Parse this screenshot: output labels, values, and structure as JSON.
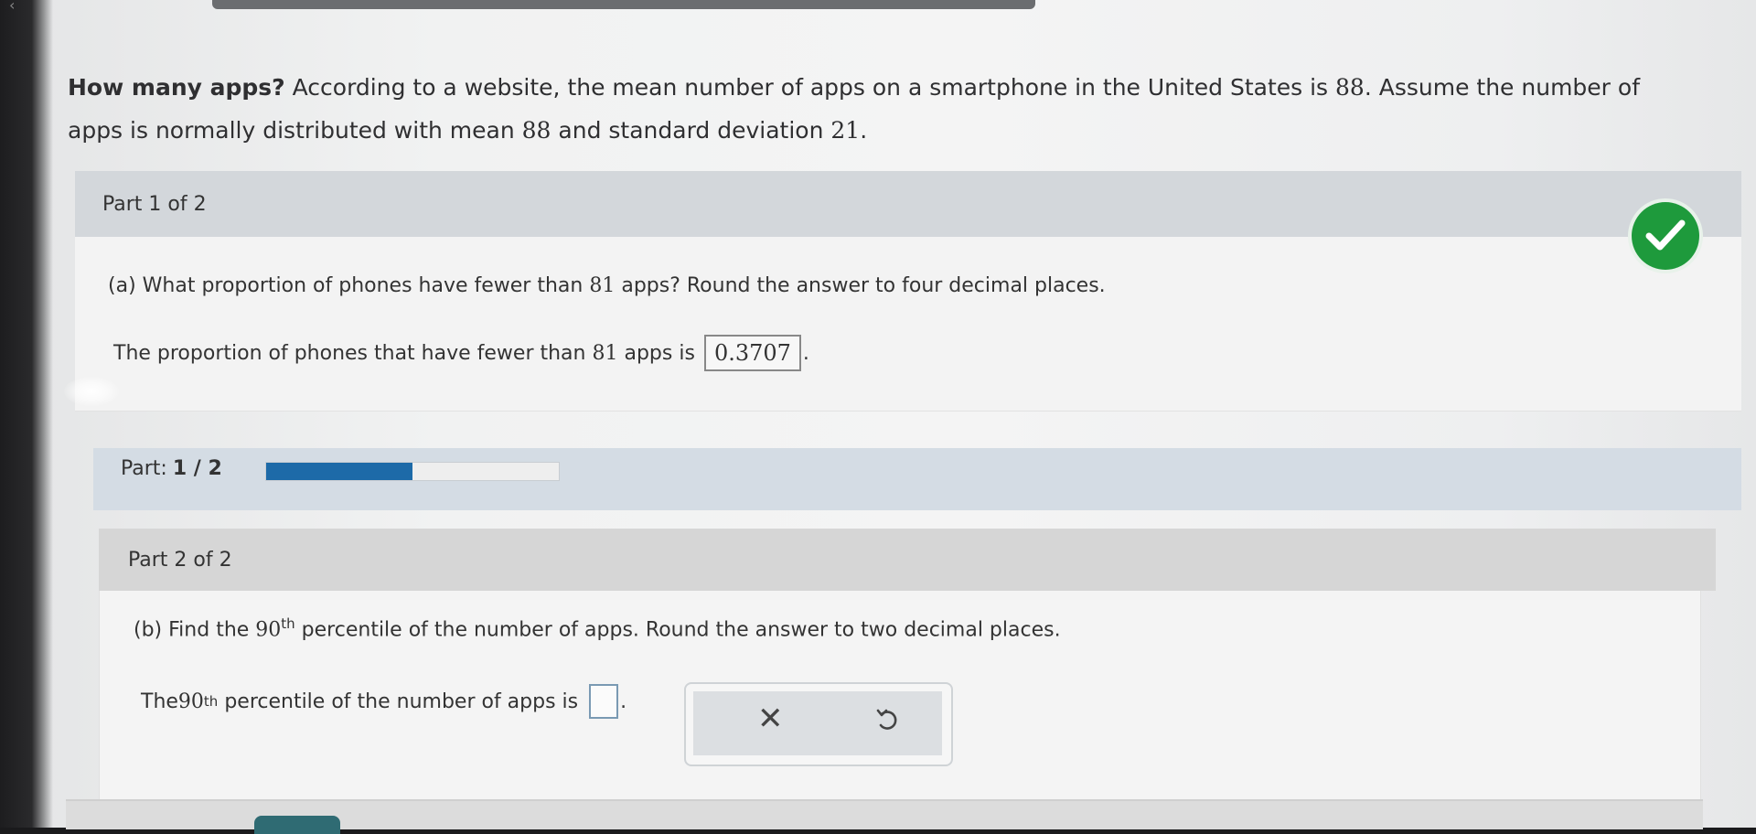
{
  "question": {
    "title": "How many apps?",
    "text_prefix": "According to a website, the mean number of apps on a smartphone in the United States is ",
    "mean": "88",
    "text_mid": ". Assume the number of apps is normally distributed with mean ",
    "mean2": "88",
    "text_and": " and standard deviation ",
    "sd": "21",
    "text_end": "."
  },
  "part1": {
    "header": "Part 1 of 2",
    "question_prefix": "(a) What proportion of phones have fewer than ",
    "question_num": "81",
    "question_suffix": " apps? Round the answer to four decimal places.",
    "answer_prefix": "The proportion of phones that have fewer than ",
    "answer_num": "81",
    "answer_suffix": " apps is",
    "answer_value": "0.3707",
    "answer_period": ".",
    "status_icon": "check-icon",
    "status_color": "#1e9a3c"
  },
  "progress": {
    "label": "Part:",
    "value_text": "1 / 2",
    "fraction": 0.5,
    "fill_color": "#1d6aa8"
  },
  "part2": {
    "header": "Part 2 of 2",
    "question_prefix": "(b) Find the ",
    "question_num": "90",
    "question_sup": "th",
    "question_suffix": " percentile of the number of apps. Round the answer to two decimal places.",
    "answer_prefix": "The ",
    "answer_num": "90",
    "answer_sup": "th",
    "answer_suffix": " percentile of the number of apps is",
    "answer_value": "",
    "answer_period": "."
  },
  "actions": {
    "clear_icon": "close-icon",
    "undo_icon": "undo-icon"
  }
}
